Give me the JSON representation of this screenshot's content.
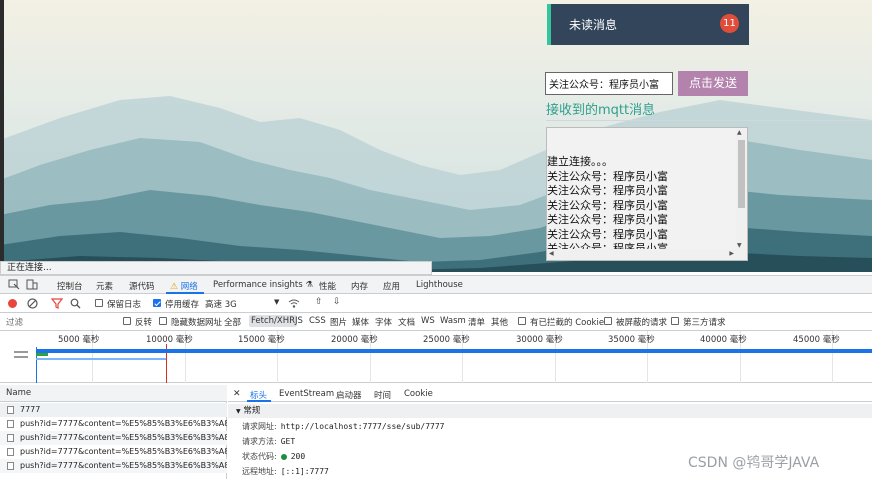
{
  "page": {
    "unread_label": "未读消息",
    "unread_count": "11",
    "send_input_value": "关注公众号：程序员小富",
    "send_button": "点击发送",
    "received_title": "接收到的mqtt消息",
    "messages": [
      "建立连接。。。",
      "关注公众号：程序员小富",
      "关注公众号：程序员小富",
      "关注公众号：程序员小富",
      "关注公众号：程序员小富",
      "关注公众号：程序员小富",
      "关注公众号：程序员小富"
    ],
    "status_text": "正在连接..."
  },
  "devtools": {
    "tabs": [
      "控制台",
      "元素",
      "源代码",
      "网络",
      "Performance insights",
      "性能",
      "内存",
      "应用",
      "Lighthouse"
    ],
    "active_tab": "网络",
    "toolbar": {
      "preserve_log": "保留日志",
      "disable_cache": "停用缓存",
      "throttle": "高速 3G"
    },
    "filter": {
      "placeholder": "过滤",
      "invert": "反转",
      "hide_data_urls": "隐藏数据网址",
      "types": [
        "全部",
        "Fetch/XHR",
        "JS",
        "CSS",
        "图片",
        "媒体",
        "字体",
        "文档",
        "WS",
        "Wasm",
        "清单",
        "其他"
      ],
      "selected_type": "Fetch/XHR",
      "blocked_cookies": "有已拦截的 Cookie",
      "blocked_requests": "被屏蔽的请求",
      "third_party": "第三方请求"
    },
    "timeline_ticks": [
      "5000 毫秒",
      "10000 毫秒",
      "15000 毫秒",
      "20000 毫秒",
      "25000 毫秒",
      "30000 毫秒",
      "35000 毫秒",
      "40000 毫秒",
      "45000 毫秒"
    ],
    "requests_header": "Name",
    "requests": [
      "7777",
      "push?id=7777&content=%E5%85%B3%E6%B3%A8%E...",
      "push?id=7777&content=%E5%85%B3%E6%B3%A8%E...",
      "push?id=7777&content=%E5%85%B3%E6%B3%A8%E...",
      "push?id=7777&content=%E5%85%B3%E6%B3%A8%E..."
    ],
    "detail_tabs": [
      "标头",
      "EventStream",
      "启动器",
      "时间",
      "Cookie"
    ],
    "active_detail_tab": "标头",
    "general_section": "常规",
    "general": {
      "request_url_label": "请求网址:",
      "request_url": "http://localhost:7777/sse/sub/7777",
      "method_label": "请求方法:",
      "method": "GET",
      "status_label": "状态代码:",
      "status": "200",
      "remote_label": "远程地址:",
      "remote": "[::1]:7777"
    }
  },
  "watermark": "CSDN @鸨哥学JAVA",
  "colors": {
    "unread_bg": "#33455a",
    "unread_accent": "#35c59c",
    "badge": "#e24d3b",
    "send_button": "#b382ad",
    "title_teal": "#2e9f8e",
    "devtools_blue": "#1a73e8"
  }
}
